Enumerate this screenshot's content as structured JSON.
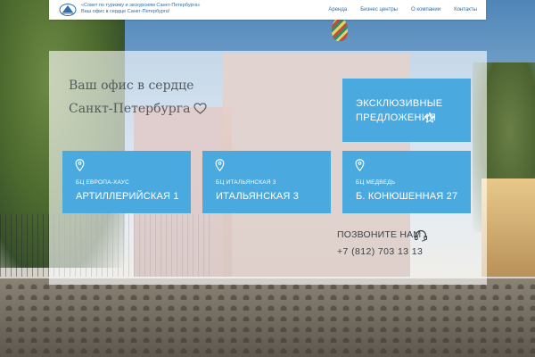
{
  "header": {
    "logo_line1": "«Совет по туризму и экскурсиям Санкт-Петербурга»",
    "logo_line2": "Ваш офис в сердце Санкт-Петербурга!",
    "nav": [
      "Аренда",
      "Бизнес центры",
      "О компании",
      "Контакты"
    ]
  },
  "hero": {
    "line1": "Ваш офис в сердце",
    "line2": "Санкт-Петербурга"
  },
  "exclusive": {
    "line1": "ЭКСКЛЮЗИВНЫЕ",
    "line2": "ПРЕДЛОЖЕНИЯ"
  },
  "offices": [
    {
      "name": "БЦ ЕВРОПА-ХАУС",
      "address": "АРТИЛЛЕРИЙСКАЯ 1"
    },
    {
      "name": "БЦ ИТАЛЬЯНСКАЯ 3",
      "address": "ИТАЛЬЯНСКАЯ 3"
    },
    {
      "name": "БЦ МЕДВЕДЬ",
      "address": "Б. КОНЮШЕННАЯ 27"
    }
  ],
  "contact": {
    "title": "ПОЗВОНИТЕ НАМ",
    "phone": "+7 (812) 703 13 13"
  },
  "colors": {
    "accent": "#4aaae0",
    "brand_text": "#2f6ea8",
    "panel": "rgba(255,255,255,0.62)"
  },
  "icons": [
    "logo-icon",
    "heart-icon",
    "star-icon",
    "map-pin-icon",
    "headset-icon"
  ]
}
